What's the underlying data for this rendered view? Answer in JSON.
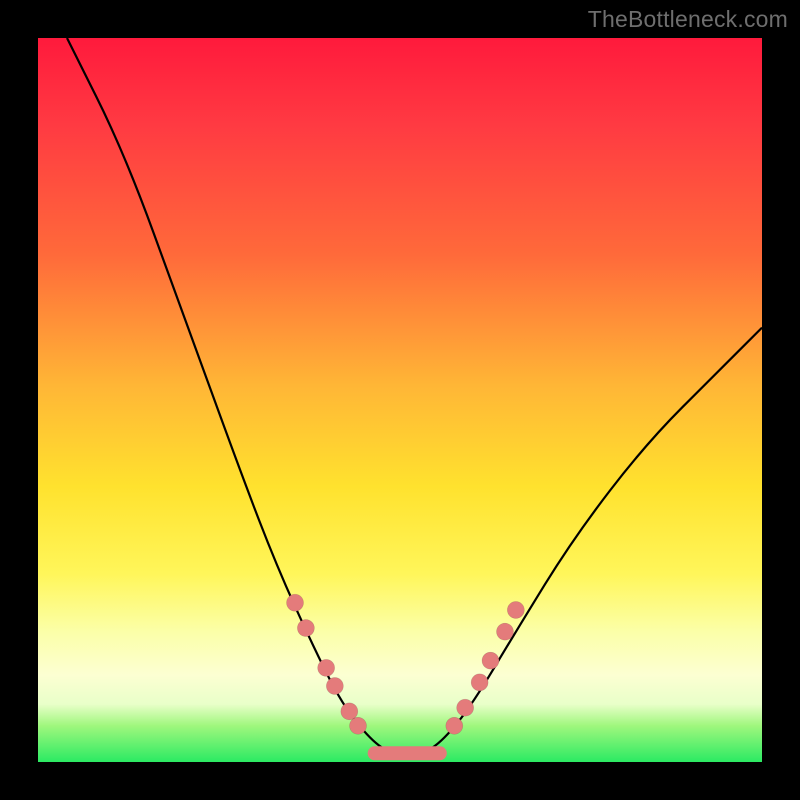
{
  "watermark": "TheBottleneck.com",
  "colors": {
    "dot": "#e47b7b",
    "curve": "#000000"
  },
  "chart_data": {
    "type": "line",
    "title": "",
    "xlabel": "",
    "ylabel": "",
    "xlim": [
      0,
      100
    ],
    "ylim": [
      0,
      100
    ],
    "grid": false,
    "curve": [
      {
        "x": 4,
        "y": 100
      },
      {
        "x": 12,
        "y": 84
      },
      {
        "x": 20,
        "y": 62
      },
      {
        "x": 28,
        "y": 40
      },
      {
        "x": 33,
        "y": 27
      },
      {
        "x": 38,
        "y": 16
      },
      {
        "x": 42,
        "y": 8
      },
      {
        "x": 46,
        "y": 3
      },
      {
        "x": 49,
        "y": 1
      },
      {
        "x": 53,
        "y": 1
      },
      {
        "x": 56,
        "y": 3
      },
      {
        "x": 60,
        "y": 8
      },
      {
        "x": 66,
        "y": 18
      },
      {
        "x": 74,
        "y": 31
      },
      {
        "x": 84,
        "y": 44
      },
      {
        "x": 94,
        "y": 54
      },
      {
        "x": 100,
        "y": 60
      }
    ],
    "left_dots": [
      {
        "x": 35.5,
        "y": 22
      },
      {
        "x": 37.0,
        "y": 18.5
      },
      {
        "x": 39.8,
        "y": 13
      },
      {
        "x": 41.0,
        "y": 10.5
      },
      {
        "x": 43.0,
        "y": 7
      },
      {
        "x": 44.2,
        "y": 5
      }
    ],
    "right_dots": [
      {
        "x": 57.5,
        "y": 5
      },
      {
        "x": 59.0,
        "y": 7.5
      },
      {
        "x": 61.0,
        "y": 11
      },
      {
        "x": 62.5,
        "y": 14
      },
      {
        "x": 64.5,
        "y": 18
      },
      {
        "x": 66.0,
        "y": 21
      }
    ],
    "plateau": {
      "x0": 46.5,
      "x1": 55.5,
      "y": 1.2
    }
  }
}
